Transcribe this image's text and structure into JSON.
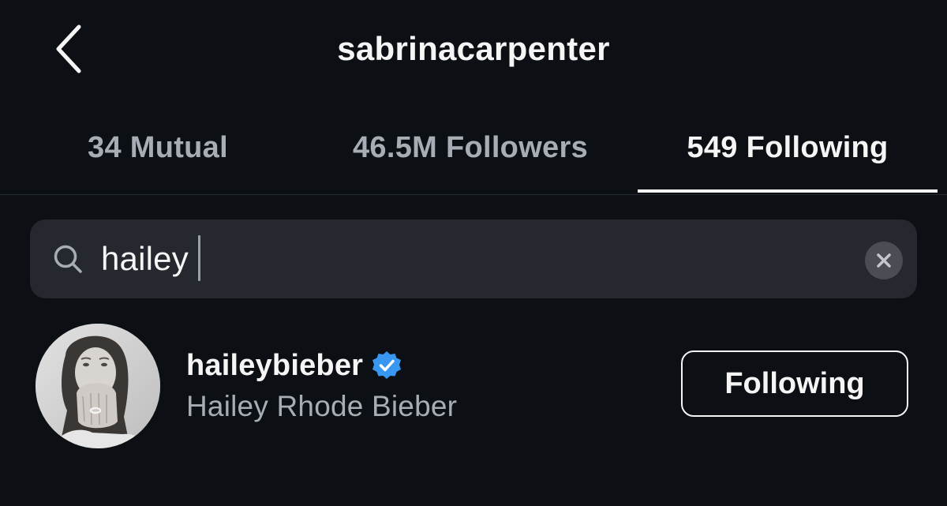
{
  "header": {
    "title": "sabrinacarpenter",
    "back_icon": "chevron-left-icon"
  },
  "tabs": [
    {
      "label": "34 Mutual",
      "active": false
    },
    {
      "label": "46.5M Followers",
      "active": false
    },
    {
      "label": "549 Following",
      "active": true
    }
  ],
  "search": {
    "value": "hailey",
    "icon": "search-icon",
    "clear_icon": "close-icon"
  },
  "results": [
    {
      "username": "haileybieber",
      "verified": true,
      "full_name": "Hailey Rhode Bieber",
      "button_label": "Following"
    }
  ],
  "colors": {
    "background": "#0c0f14",
    "text_primary": "#f5f5f5",
    "text_secondary": "#a8adb5",
    "search_background": "#25282e",
    "verified_blue": "#3897f0"
  }
}
